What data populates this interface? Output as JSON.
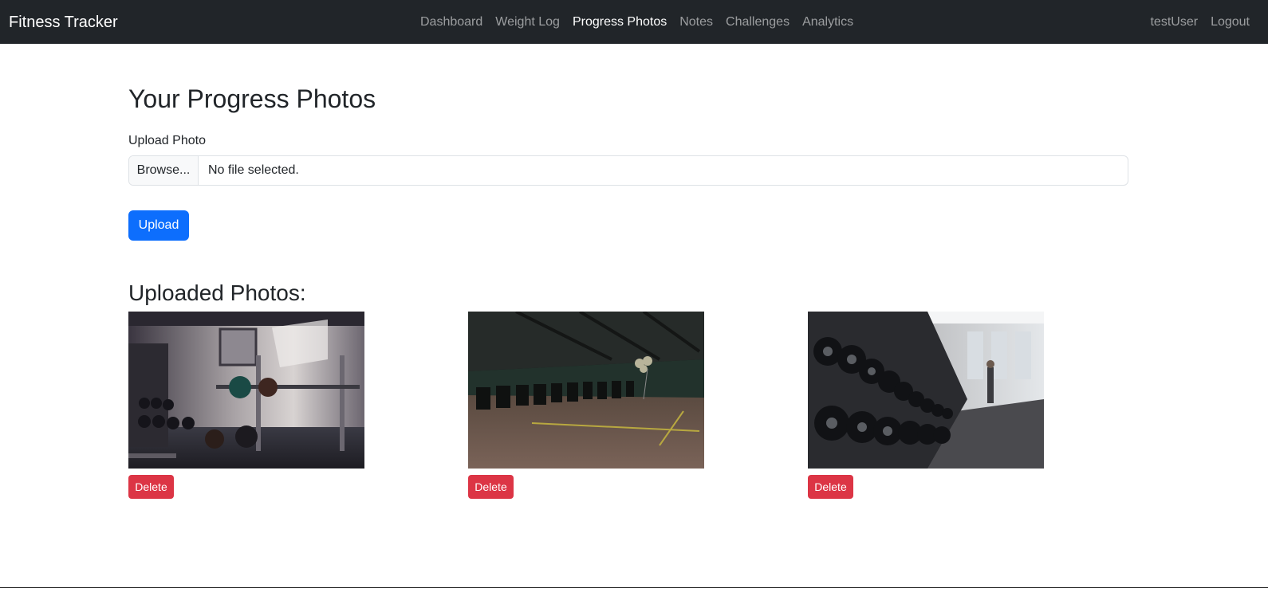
{
  "navbar": {
    "brand": "Fitness Tracker",
    "links": [
      {
        "label": "Dashboard",
        "active": false
      },
      {
        "label": "Weight Log",
        "active": false
      },
      {
        "label": "Progress Photos",
        "active": true
      },
      {
        "label": "Notes",
        "active": false
      },
      {
        "label": "Challenges",
        "active": false
      },
      {
        "label": "Analytics",
        "active": false
      }
    ],
    "user": "testUser",
    "logout": "Logout"
  },
  "page": {
    "title": "Your Progress Photos",
    "upload_label": "Upload Photo",
    "browse_label": "Browse...",
    "file_status": "No file selected.",
    "upload_button": "Upload",
    "uploaded_title": "Uploaded Photos:"
  },
  "photos": [
    {
      "subject": "gym-squat-rack-photo",
      "delete_label": "Delete"
    },
    {
      "subject": "gym-treadmill-hall-photo",
      "delete_label": "Delete"
    },
    {
      "subject": "gym-dumbbell-rack-photo",
      "delete_label": "Delete"
    }
  ],
  "colors": {
    "navbar_bg": "#212529",
    "primary": "#0d6efd",
    "danger": "#dc3545"
  }
}
